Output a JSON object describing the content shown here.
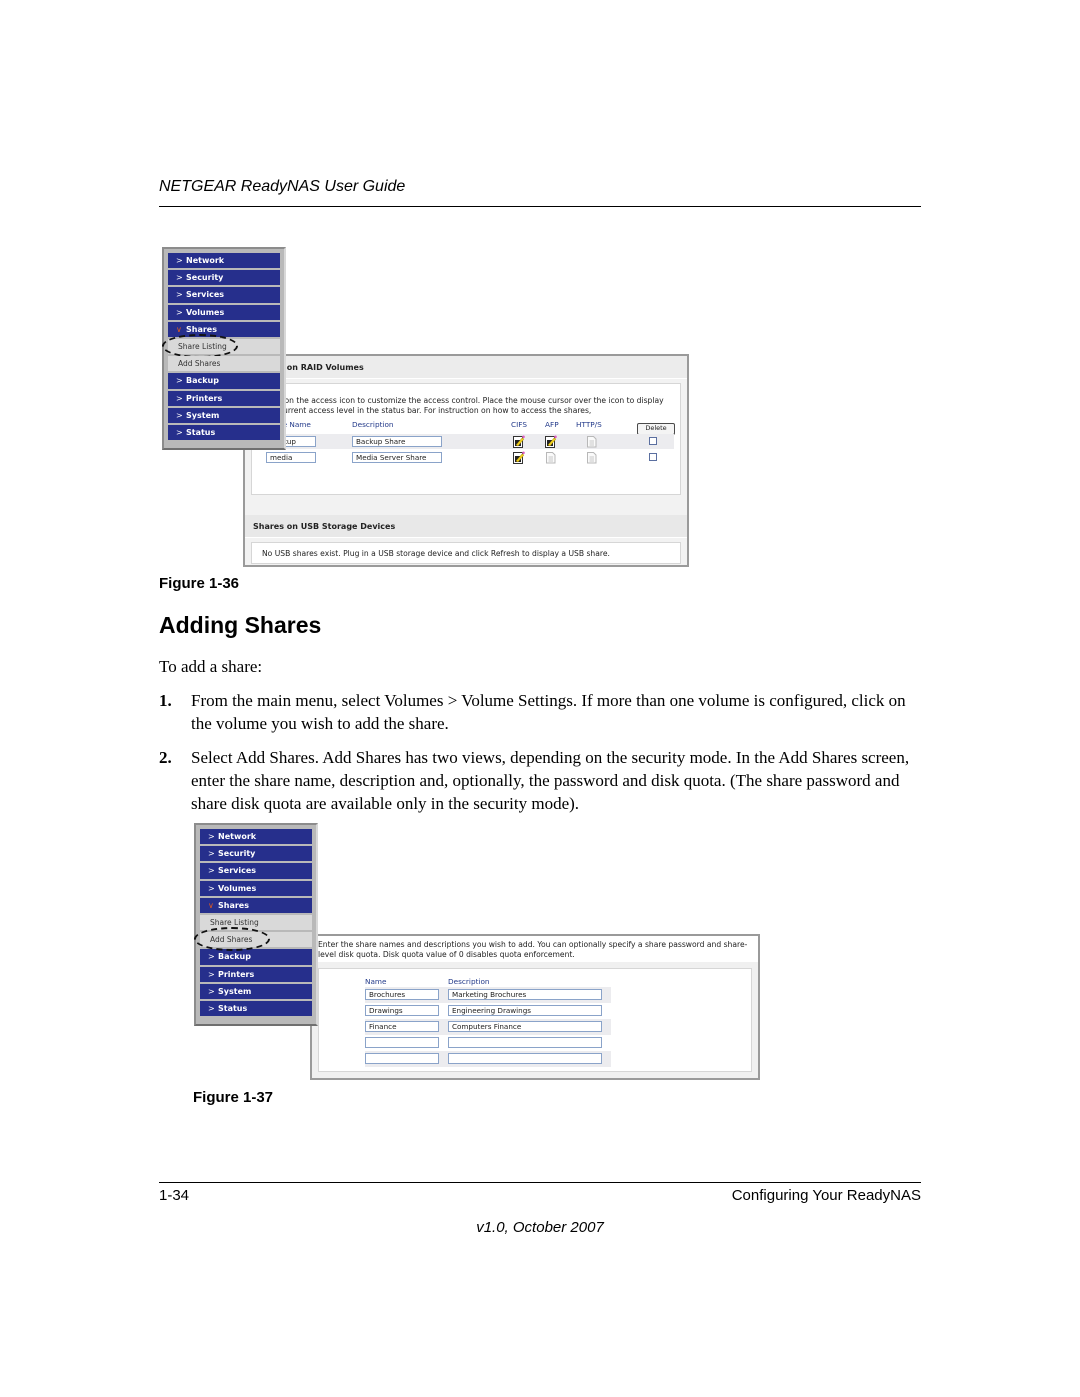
{
  "header": {
    "title": "NETGEAR ReadyNAS User Guide"
  },
  "figure36": {
    "caption": "Figure 1-36",
    "nav": {
      "top_items": [
        {
          "label": "Network",
          "icon": "chevron-right-icon"
        },
        {
          "label": "Security",
          "icon": "chevron-right-icon"
        },
        {
          "label": "Services",
          "icon": "chevron-right-icon"
        },
        {
          "label": "Volumes",
          "icon": "chevron-right-icon"
        },
        {
          "label": "Shares",
          "icon": "chevron-down-icon"
        }
      ],
      "sub_items": [
        {
          "label": "Share Listing",
          "highlighted": true
        },
        {
          "label": "Add Shares",
          "highlighted": false
        }
      ],
      "bottom_items": [
        {
          "label": "Backup",
          "icon": "chevron-right-icon"
        },
        {
          "label": "Printers",
          "icon": "chevron-right-icon"
        },
        {
          "label": "System",
          "icon": "chevron-right-icon"
        },
        {
          "label": "Status",
          "icon": "chevron-right-icon"
        }
      ]
    },
    "raid_section": {
      "title": "Shares on RAID Volumes",
      "intro": "Click on the access icon to customize the access control. Place the mouse cursor over the icon to display the current access level in the status bar. For instruction on how to access the shares,",
      "columns": [
        "Share Name",
        "Description",
        "CIFS",
        "AFP",
        "HTTP/S"
      ],
      "delete_label": "Delete",
      "rows": [
        {
          "name": "backup",
          "description": "Backup Share",
          "cifs": "edit-enabled",
          "afp": "edit-enabled",
          "https": "disabled",
          "selected": false
        },
        {
          "name": "media",
          "description": "Media Server Share",
          "cifs": "edit-enabled",
          "afp": "disabled",
          "https": "disabled",
          "selected": false
        }
      ]
    },
    "usb_section": {
      "title": "Shares on USB Storage Devices",
      "message": "No USB shares exist. Plug in a USB storage device and click Refresh to display a USB share."
    }
  },
  "section": {
    "heading": "Adding Shares",
    "intro": "To add a share:",
    "steps": [
      {
        "num": "1.",
        "text": "From the main menu, select Volumes > Volume Settings. If more than one volume is configured, click on the volume you wish to add the share."
      },
      {
        "num": "2.",
        "text": "Select Add Shares. Add Shares has two views, depending on the security mode. In the Add Shares screen, enter the share name, description and, optionally, the password and disk quota. (The share password and share disk quota are available only in the security mode)."
      }
    ]
  },
  "figure37": {
    "caption": "Figure 1-37",
    "nav": {
      "top_items": [
        {
          "label": "Network"
        },
        {
          "label": "Security"
        },
        {
          "label": "Services"
        },
        {
          "label": "Volumes"
        },
        {
          "label": "Shares"
        }
      ],
      "sub_items": [
        {
          "label": "Share Listing",
          "highlighted": false
        },
        {
          "label": "Add Shares",
          "highlighted": true
        }
      ],
      "bottom_items": [
        {
          "label": "Backup"
        },
        {
          "label": "Printers"
        },
        {
          "label": "System"
        },
        {
          "label": "Status"
        }
      ]
    },
    "intro": "Enter the share names and descriptions you wish to add.  You can optionally specify a share password and share-level disk quota. Disk quota value of 0 disables quota enforcement.",
    "columns": [
      "Name",
      "Description"
    ],
    "rows": [
      {
        "name": "Brochures",
        "description": "Marketing Brochures"
      },
      {
        "name": "Drawings",
        "description": "Engineering Drawings"
      },
      {
        "name": "Finance",
        "description": "Computers Finance"
      },
      {
        "name": "",
        "description": ""
      },
      {
        "name": "",
        "description": ""
      }
    ]
  },
  "footer": {
    "page": "1-34",
    "chapter": "Configuring Your ReadyNAS",
    "version": "v1.0, October 2007"
  }
}
